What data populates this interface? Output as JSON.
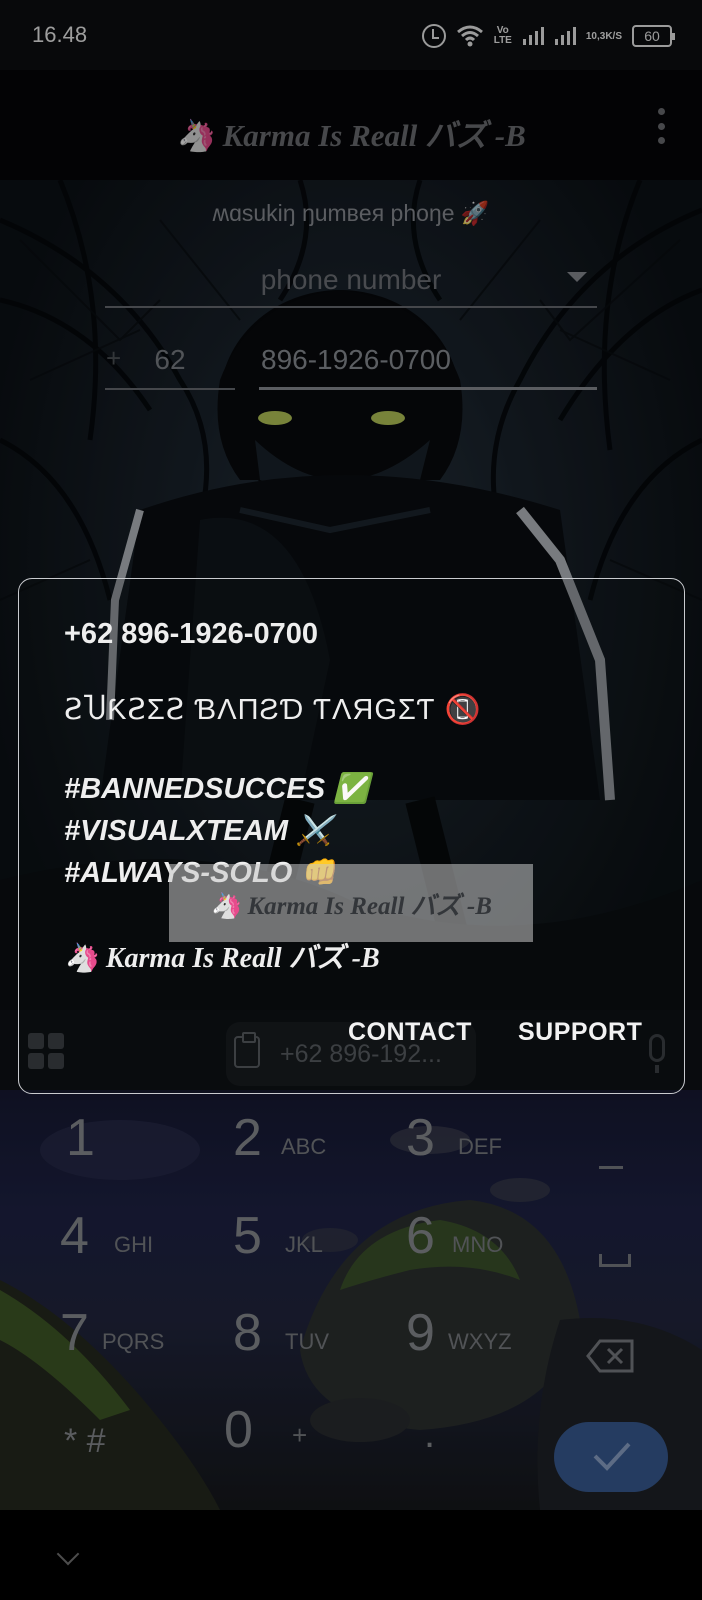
{
  "status_bar": {
    "time": "16.48",
    "volte": "Vo\nLTE",
    "speed_value": "10,3",
    "speed_unit": "K/S",
    "battery": "60"
  },
  "toolbar": {
    "title": "🦄 Karma Is Reall バズ -B"
  },
  "form": {
    "heading": "ʍɑsukiŋ ŋumвeя phoŋe 🚀",
    "select_value": "phone number",
    "plus": "+",
    "country_code": "62",
    "phone_value": "896-1926-0700"
  },
  "dialog": {
    "number": "+62 896-1926-0700",
    "status": "ꙄႮƘꙄƩꙄ ƁΛПƧƊ ƬΛЯGƩƬ 📵",
    "tags": [
      "#BANNEDSUCCES ✅",
      "#VISUALXTEAM ⚔️",
      "#ALWAYS-SOLO 👊"
    ],
    "signature": "🦄 Karma Is Reall バズ -B",
    "buttons": {
      "contact": "CONTACT",
      "support": "SUPPORT"
    }
  },
  "toast": {
    "text": "🦄 Karma Is Reall バズ -B"
  },
  "dialer": {
    "paste_suggestion": "+62 896-192...",
    "keys": [
      {
        "num": "1",
        "letters": ""
      },
      {
        "num": "2",
        "letters": "ABC"
      },
      {
        "num": "3",
        "letters": "DEF"
      },
      {
        "num": "4",
        "letters": "GHI"
      },
      {
        "num": "5",
        "letters": "JKL"
      },
      {
        "num": "6",
        "letters": "MNO"
      },
      {
        "num": "7",
        "letters": "PQRS"
      },
      {
        "num": "8",
        "letters": "TUV"
      },
      {
        "num": "9",
        "letters": "WXYZ"
      },
      {
        "num": "* #",
        "letters": ""
      },
      {
        "num": "0",
        "letters": "+"
      },
      {
        "num": ".",
        "letters": ""
      }
    ]
  },
  "colors": {
    "accent": "#3a5d95",
    "dialog_border": "#c9cbcf"
  }
}
